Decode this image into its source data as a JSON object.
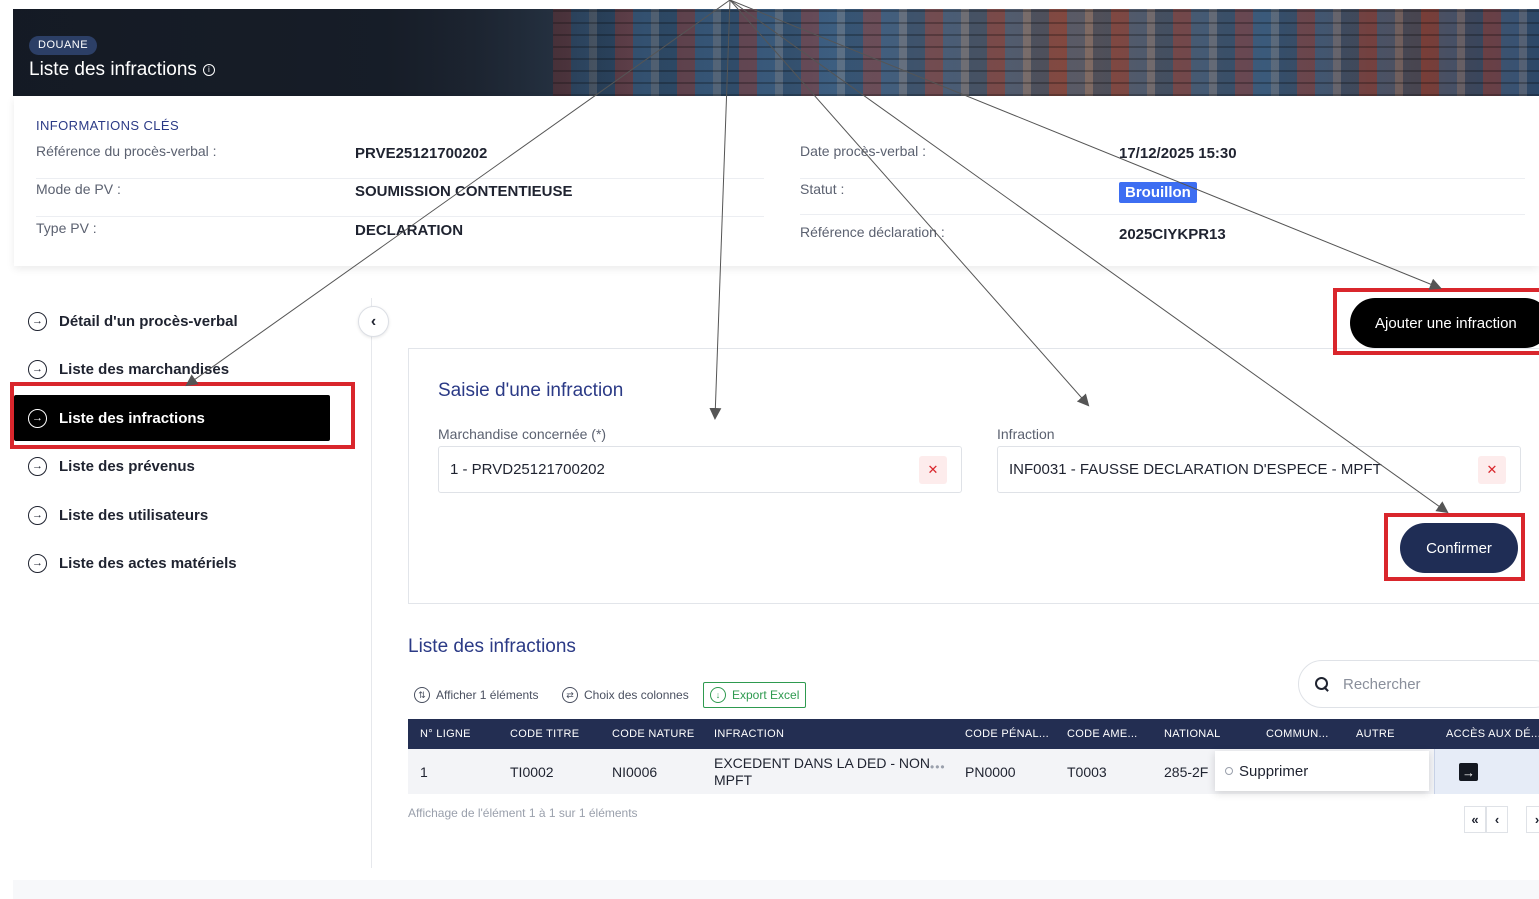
{
  "header": {
    "tag": "DOUANE",
    "title": "Liste des infractions",
    "info_icon": "info-icon"
  },
  "key_info": {
    "title": "INFORMATIONS CLÉS",
    "left": [
      {
        "label": "Référence du procès-verbal :",
        "value": "PRVE25121700202"
      },
      {
        "label": "Mode de PV :",
        "value": "SOUMISSION CONTENTIEUSE"
      },
      {
        "label": "Type PV :",
        "value": "DECLARATION"
      }
    ],
    "right": [
      {
        "label": "Date procès-verbal :",
        "value": "17/12/2025 15:30"
      },
      {
        "label": "Statut :",
        "value": "Brouillon"
      },
      {
        "label": "Référence déclaration :",
        "value": "2025CIYKPR13"
      }
    ],
    "status_color": "#3d6ef2"
  },
  "sidebar": {
    "items": [
      {
        "label": "Détail d'un procès-verbal",
        "active": false
      },
      {
        "label": "Liste des marchandises",
        "active": false
      },
      {
        "label": "Liste des infractions",
        "active": true
      },
      {
        "label": "Liste des prévenus",
        "active": false
      },
      {
        "label": "Liste des utilisateurs",
        "active": false
      },
      {
        "label": "Liste des actes matériels",
        "active": false
      }
    ],
    "item_icon": "arrow-circle-right-icon",
    "collapse_icon": "chevron-left-icon"
  },
  "actions": {
    "add_infraction": "Ajouter une infraction",
    "confirm": "Confirmer"
  },
  "entry_form": {
    "title": "Saisie d'une infraction",
    "merchandise": {
      "label": "Marchandise concernée (*)",
      "value": "1 - PRVD25121700202"
    },
    "infraction": {
      "label": "Infraction",
      "value": "INF0031 - FAUSSE DECLARATION D'ESPECE - MPFT"
    },
    "clear_icon": "close-icon"
  },
  "list": {
    "title": "Liste des infractions",
    "toolbar": {
      "show": "Afficher 1 éléments",
      "columns": "Choix des colonnes",
      "export": "Export Excel"
    },
    "search_placeholder": "Rechercher",
    "columns": [
      "N° LIGNE",
      "CODE TITRE",
      "CODE NATURE",
      "INFRACTION",
      "CODE PÉNAL...",
      "CODE AME...",
      "NATIONAL",
      "COMMUN...",
      "AUTRE",
      "ACCÈS AUX DÉ..."
    ],
    "rows": [
      {
        "ligne": "1",
        "code_titre": "TI0002",
        "code_nature": "NI0006",
        "infraction": "EXCEDENT DANS LA DED - NON MPFT",
        "code_penal": "PN0000",
        "code_ame": "T0003",
        "national": "285-2F",
        "commun": "",
        "autre": ""
      }
    ],
    "row_menu": {
      "delete": "Supprimer"
    },
    "footer": "Affichage de l'élément 1 à 1 sur 1 éléments",
    "pager": {
      "first": "«",
      "prev": "‹",
      "next": "›"
    }
  },
  "colors": {
    "accent_navy": "#232e52",
    "title_blue": "#2b3a86",
    "highlight_red": "#d9262c"
  }
}
